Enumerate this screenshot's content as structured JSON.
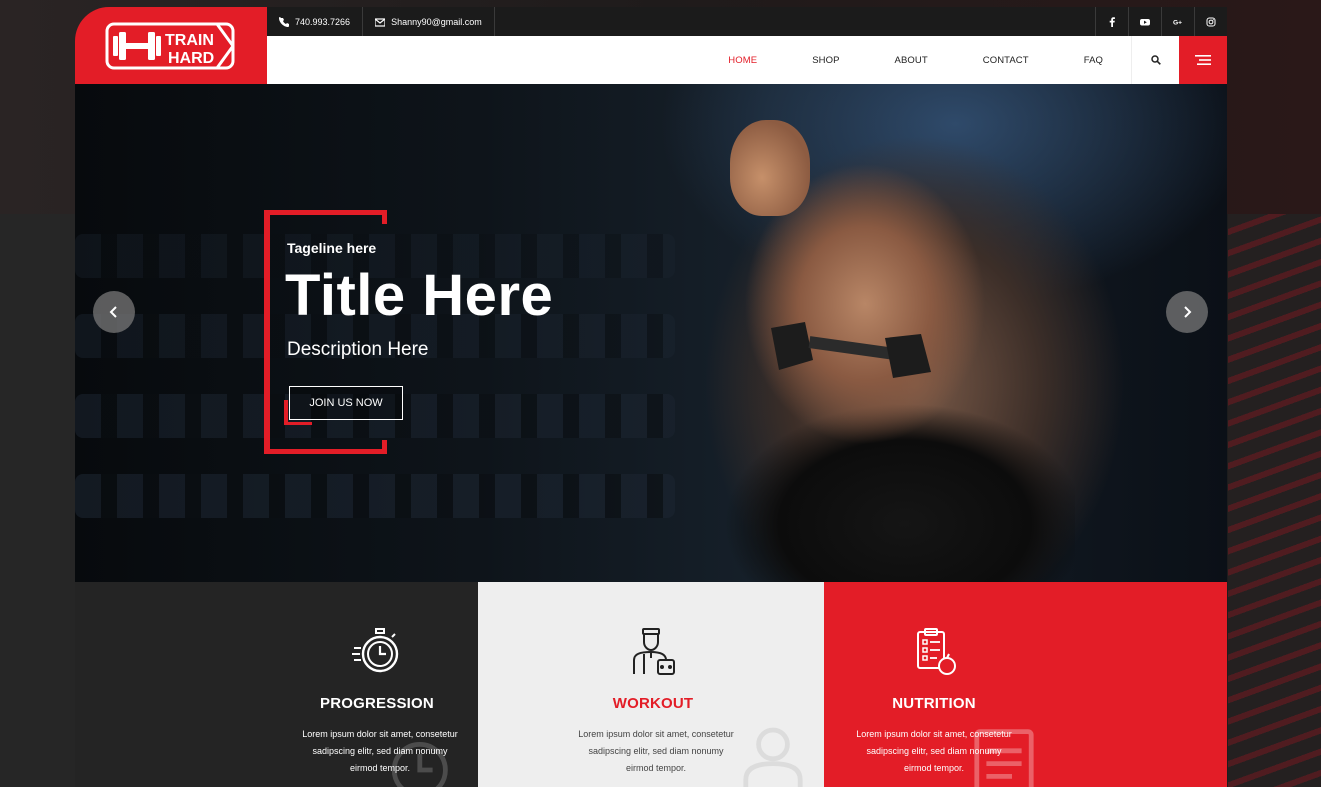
{
  "brand": {
    "logo_line1": "TRAIN",
    "logo_line2": "HARD",
    "accent_color": "#e31d27"
  },
  "topbar": {
    "phone": "740.993.7266",
    "email": "Shanny90@gmail.com",
    "social": [
      "facebook-icon",
      "youtube-icon",
      "google-plus-icon",
      "instagram-icon"
    ]
  },
  "nav": {
    "items": [
      {
        "label": "HOME",
        "active": true
      },
      {
        "label": "SHOP"
      },
      {
        "label": "ABOUT"
      },
      {
        "label": "CONTACT"
      },
      {
        "label": "FAQ"
      }
    ]
  },
  "hero": {
    "tagline": "Tageline here",
    "title": "Title Here",
    "description": "Description Here",
    "cta": "JOIN US NOW"
  },
  "features": [
    {
      "title": "PROGRESSION",
      "text": "Lorem ipsum dolor sit amet, consetetur sadipscing elitr, sed diam nonumy eirmod tempor.",
      "icon": "stopwatch-icon"
    },
    {
      "title": "WORKOUT",
      "text": "Lorem ipsum dolor sit amet, consetetur sadipscing elitr, sed diam nonumy eirmod tempor.",
      "icon": "trainer-icon"
    },
    {
      "title": "NUTRITION",
      "text": "Lorem ipsum dolor sit amet, consetetur sadipscing elitr, sed diam nonumy eirmod tempor.",
      "icon": "diet-clipboard-icon"
    }
  ]
}
